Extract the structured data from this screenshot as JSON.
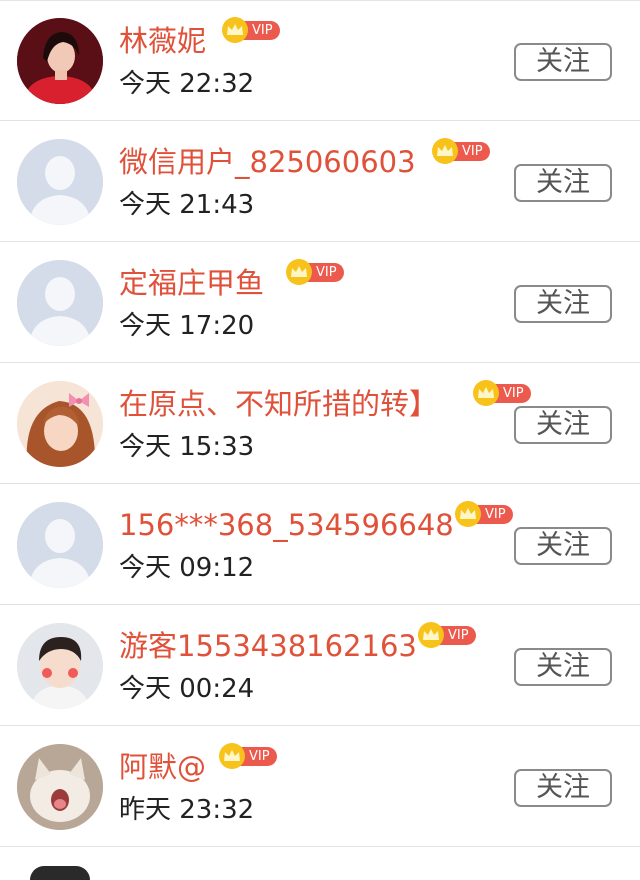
{
  "follow_label": "关注",
  "vip_label": "VIP",
  "colors": {
    "name": "#e0513a",
    "vip_badge": "#ec5a4e",
    "crown": "#f7c21a",
    "avatar_placeholder": "#d4dbe9"
  },
  "users": [
    {
      "name": "林薇妮",
      "time": "今天 22:32",
      "avatar": "photo-woman-red-dress"
    },
    {
      "name": "微信用户_825060603",
      "time": "今天 21:43",
      "avatar": "default-person-icon"
    },
    {
      "name": "定福庄甲鱼",
      "time": "今天 17:20",
      "avatar": "default-person-icon"
    },
    {
      "name": "在原点、不知所措的转】",
      "time": "今天 15:33",
      "avatar": "photo-girl-pink-bow"
    },
    {
      "name": "156***368_534596648",
      "time": "今天 09:12",
      "avatar": "default-person-icon"
    },
    {
      "name": "游客1553438162163",
      "time": "今天 00:24",
      "avatar": "photo-boy"
    },
    {
      "name": "阿默@",
      "time": "昨天 23:32",
      "avatar": "photo-kitten"
    }
  ]
}
